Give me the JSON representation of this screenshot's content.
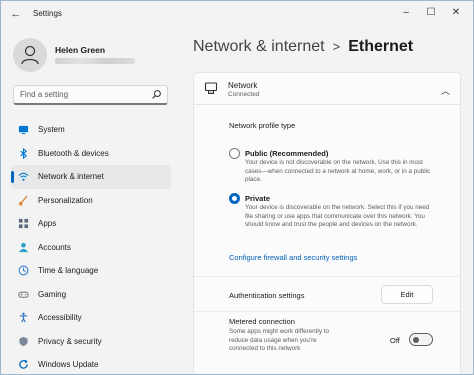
{
  "titlebar": {
    "app_title": "Settings",
    "minimize": "–",
    "maximize": "☐",
    "close": "✕"
  },
  "user": {
    "name": "Helen Green"
  },
  "search": {
    "placeholder": "Find a setting"
  },
  "sidebar": {
    "items": [
      {
        "label": "System",
        "icon": "monitor-icon",
        "color": "#0078d4"
      },
      {
        "label": "Bluetooth & devices",
        "icon": "bluetooth-icon",
        "color": "#0078d4"
      },
      {
        "label": "Network & internet",
        "icon": "wifi-icon",
        "color": "#0078d4",
        "active": true
      },
      {
        "label": "Personalization",
        "icon": "brush-icon",
        "color": "#e08a3c"
      },
      {
        "label": "Apps",
        "icon": "apps-icon",
        "color": "#5a6a7a"
      },
      {
        "label": "Accounts",
        "icon": "person-icon",
        "color": "#2aa1c7"
      },
      {
        "label": "Time & language",
        "icon": "globe-clock-icon",
        "color": "#2f7fd0"
      },
      {
        "label": "Gaming",
        "icon": "gamepad-icon",
        "color": "#7a7a7a"
      },
      {
        "label": "Accessibility",
        "icon": "accessibility-icon",
        "color": "#2f6fc0"
      },
      {
        "label": "Privacy & security",
        "icon": "shield-icon",
        "color": "#7a8a9a"
      },
      {
        "label": "Windows Update",
        "icon": "update-icon",
        "color": "#0067c0"
      }
    ]
  },
  "header": {
    "parent": "Network & internet",
    "separator": ">",
    "current": "Ethernet"
  },
  "network": {
    "title": "Network",
    "status": "Connected"
  },
  "profile": {
    "title": "Network profile type",
    "public_label": "Public (Recommended)",
    "public_desc": "Your device is not discoverable on the network. Use this in most cases—when connected to a network at home, work, or in a public place.",
    "private_label": "Private",
    "private_desc": "Your device is discoverable on the network. Select this if you need file sharing or use apps that communicate over this network. You should know and trust the people and devices on the network.",
    "selected": "Private"
  },
  "firewall_link": "Configure firewall and security settings",
  "auth": {
    "label": "Authentication settings",
    "button": "Edit"
  },
  "metered": {
    "title": "Metered connection",
    "desc": "Some apps might work differently to reduce data usage when you're connected to this network",
    "state": "Off"
  },
  "colors": {
    "accent": "#0067c0",
    "link": "#005fb8"
  }
}
